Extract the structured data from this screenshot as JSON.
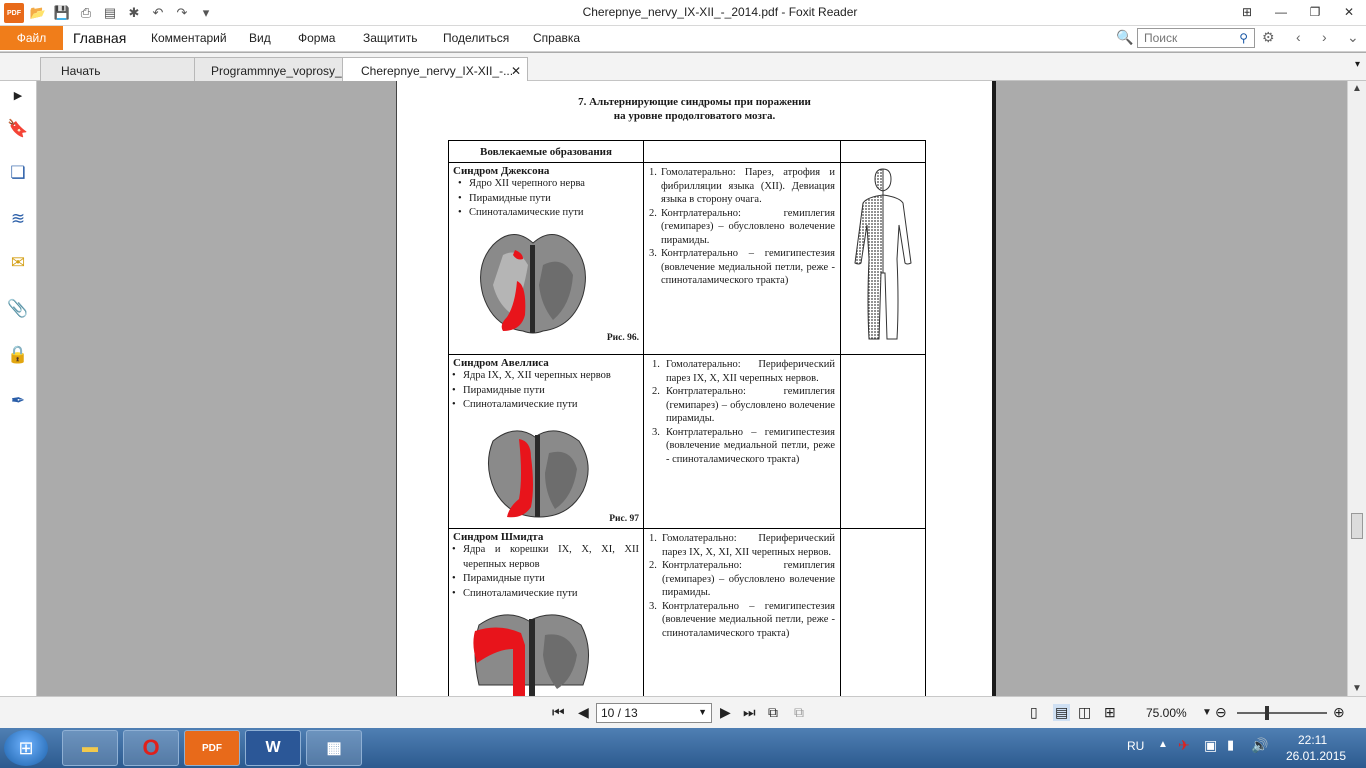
{
  "window": {
    "title": "Cherepnye_nervy_IX-XII_-_2014.pdf - Foxit Reader"
  },
  "menu": {
    "file": "Файл",
    "items": [
      "Главная",
      "Комментарий",
      "Вид",
      "Форма",
      "Защитить",
      "Поделиться",
      "Справка"
    ]
  },
  "search": {
    "placeholder": "Поиск"
  },
  "tabs": [
    {
      "label": "Начать"
    },
    {
      "label": "Programmnye_voprosy_d..."
    },
    {
      "label": "Cherepnye_nervy_IX-XII_-..."
    }
  ],
  "document": {
    "heading_line1": "7. Альтернирующие синдромы при поражении",
    "heading_line2": "на уровне продолговатого мозга.",
    "table_header": "Вовлекаемые образования",
    "rows": [
      {
        "name": "Синдром Джексона",
        "bullets": [
          "Ядро XII черепного нерва",
          "Пирамидные пути",
          "Спиноталамические пути"
        ],
        "figure": "Рис. 96.",
        "items": [
          {
            "n": "1.",
            "text": "Гомолатерально: Парез, атрофия и фибрилляции языка (XII). Девиация языка в сторону очага."
          },
          {
            "n": "2.",
            "text": "Контрлатерально: гемиплегия (гемипарез) – обусловлено волечение пирамиды."
          },
          {
            "n": "3.",
            "text": "Контрлатерально – гемигипестезия (вовлечение медиальной петли, реже - спиноталамического тракта)"
          }
        ]
      },
      {
        "name": "Синдром Авеллиса",
        "bullets": [
          "Ядра IX, X, XII  черепных нервов",
          "Пирамидные пути",
          "Спиноталамические пути"
        ],
        "figure": "Рис. 97",
        "items": [
          {
            "n": "1.",
            "text": "Гомолатерально: Периферический парез IX, X, XII черепных нервов."
          },
          {
            "n": "2.",
            "text": "Контрлатерально: гемиплегия (гемипарез) – обусловлено волечение пирамиды."
          },
          {
            "n": "3.",
            "text": "Контрлатерально – гемигипестезия (вовлечение медиальной петли, реже - спиноталамического тракта)"
          }
        ]
      },
      {
        "name": "Синдром Шмидта",
        "bullets": [
          "Ядра и корешки IX, X, XI, XII черепных нервов",
          "Пирамидные пути",
          "Спиноталамические пути"
        ],
        "figure": "",
        "items": [
          {
            "n": "1.",
            "text": "Гомолатерально: Периферический парез IX, X, XI, XII  черепных нервов."
          },
          {
            "n": "2.",
            "text": "Контрлатерально: гемиплегия (гемипарез) – обусловлено волечение пирамиды."
          },
          {
            "n": "3.",
            "text": "Контрлатерально – гемигипестезия (вовлечение медиальной петли, реже - спиноталамического тракта)"
          }
        ]
      }
    ]
  },
  "status": {
    "page": "10 / 13",
    "zoom": "75.00%"
  },
  "taskbar": {
    "lang": "RU",
    "time": "22:11",
    "date": "26.01.2015",
    "apps": [
      "explorer-icon",
      "opera-icon",
      "foxit-pdf-icon",
      "word-icon",
      "control-panel-icon"
    ]
  },
  "colors": {
    "accent": "#f07d1a",
    "lesion": "#e8141b"
  }
}
